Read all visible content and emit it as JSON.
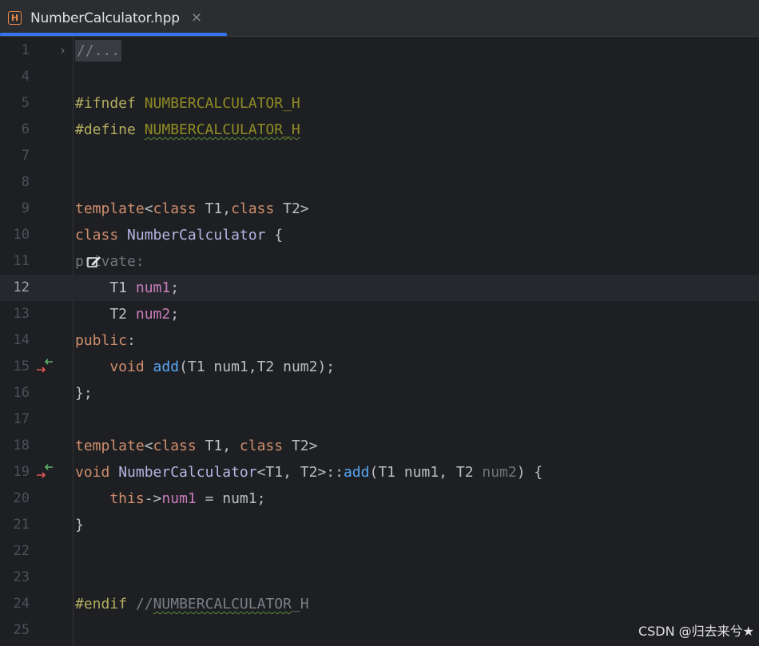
{
  "tab": {
    "icon_letter": "H",
    "filename": "NumberCalculator.hpp",
    "close_glyph": "×"
  },
  "lines": [
    {
      "num": "1"
    },
    {
      "num": "4"
    },
    {
      "num": "5"
    },
    {
      "num": "6"
    },
    {
      "num": "7"
    },
    {
      "num": "8"
    },
    {
      "num": "9"
    },
    {
      "num": "10"
    },
    {
      "num": "11"
    },
    {
      "num": "12"
    },
    {
      "num": "13"
    },
    {
      "num": "14"
    },
    {
      "num": "15"
    },
    {
      "num": "16"
    },
    {
      "num": "17"
    },
    {
      "num": "18"
    },
    {
      "num": "19"
    },
    {
      "num": "20"
    },
    {
      "num": "21"
    },
    {
      "num": "22"
    },
    {
      "num": "23"
    },
    {
      "num": "24"
    },
    {
      "num": "25"
    }
  ],
  "code": {
    "l1_folded": "//...",
    "l5_kw": "#ifndef",
    "l5_macro": "NUMBERCALCULATOR_H",
    "l6_kw": "#define",
    "l6_macro": "NUMBERCALCULATOR_H",
    "l9_template": "template",
    "l9_rest_a": "<",
    "l9_class1": "class",
    "l9_t1": " T1,",
    "l9_class2": "class",
    "l9_t2": " T2>",
    "l10_class": "class",
    "l10_name": " NumberCalculator",
    "l10_brace": " {",
    "l11_access": "private:",
    "l12_type": "    T1 ",
    "l12_field": "num1",
    "l12_semi": ";",
    "l13_type": "    T2 ",
    "l13_field": "num2",
    "l13_semi": ";",
    "l14_access": "public",
    "l14_colon": ":",
    "l15_void": "    void",
    "l15_sp": " ",
    "l15_fn": "add",
    "l15_params": "(T1 num1,T2 num2);",
    "l16_close": "};",
    "l18_template": "template",
    "l18_lt": "<",
    "l18_class1": "class",
    "l18_t1": " T1, ",
    "l18_class2": "class",
    "l18_t2": " T2>",
    "l19_void": "void",
    "l19_sp": " ",
    "l19_cls": "NumberCalculator",
    "l19_tmpl": "<T1, T2>::",
    "l19_fn": "add",
    "l19_p1": "(T1 num1, T2 ",
    "l19_p2": "num2",
    "l19_p3": ") {",
    "l20_this": "    this",
    "l20_arrow": "->",
    "l20_field": "num1",
    "l20_rest": " = num1;",
    "l21_close": "}",
    "l24_kw": "#endif",
    "l24_sp": " ",
    "l24_cmt_a": "//",
    "l24_cmt_b": "NUMBERCALCULATOR",
    "l24_cmt_c": "_H"
  },
  "watermark": "CSDN @归去来兮★",
  "colors": {
    "background": "#1e1f22",
    "tab_accent": "#3574f0",
    "keyword": "#cf8e6d",
    "macro": "#908b25",
    "function": "#56a8f5",
    "field": "#c77dbb"
  }
}
